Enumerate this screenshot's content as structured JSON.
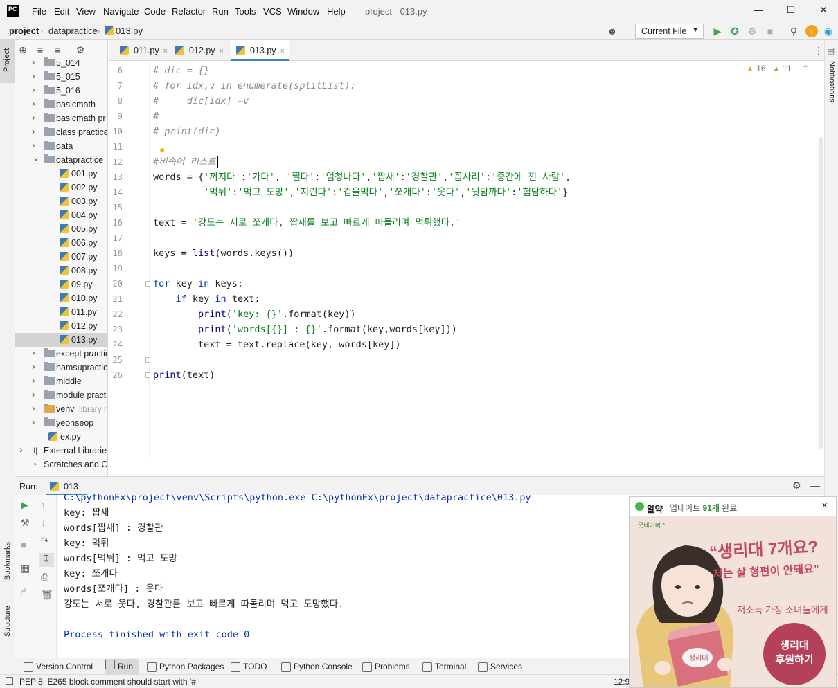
{
  "app": {
    "logo": "PC",
    "window_title": "project - 013.py"
  },
  "menu": [
    "File",
    "Edit",
    "View",
    "Navigate",
    "Code",
    "Refactor",
    "Run",
    "Tools",
    "VCS",
    "Window",
    "Help"
  ],
  "breadcrumb": {
    "project": "project",
    "folder": "datapractice",
    "file": "013.py"
  },
  "run_config": "Current File",
  "sidebar_tabs": {
    "project": "Project",
    "bookmarks": "Bookmarks",
    "structure": "Structure",
    "notifications": "Notifications"
  },
  "tree": [
    {
      "label": "5_014",
      "type": "folder",
      "indent": 1,
      "arrow": "›"
    },
    {
      "label": "5_015",
      "type": "folder",
      "indent": 1,
      "arrow": "›"
    },
    {
      "label": "5_016",
      "type": "folder",
      "indent": 1,
      "arrow": "›"
    },
    {
      "label": "basicmath",
      "type": "folder",
      "indent": 1,
      "arrow": "›"
    },
    {
      "label": "basicmath pr",
      "type": "folder",
      "indent": 1,
      "arrow": "›"
    },
    {
      "label": "class practice",
      "type": "folder",
      "indent": 1,
      "arrow": "›"
    },
    {
      "label": "data",
      "type": "folder",
      "indent": 1,
      "arrow": "›"
    },
    {
      "label": "datapractice",
      "type": "folder",
      "indent": 1,
      "arrow": "⌄"
    },
    {
      "label": "001.py",
      "type": "py",
      "indent": 2
    },
    {
      "label": "002.py",
      "type": "py",
      "indent": 2
    },
    {
      "label": "003.py",
      "type": "py",
      "indent": 2
    },
    {
      "label": "004.py",
      "type": "py",
      "indent": 2
    },
    {
      "label": "005.py",
      "type": "py",
      "indent": 2
    },
    {
      "label": "006.py",
      "type": "py",
      "indent": 2
    },
    {
      "label": "007.py",
      "type": "py",
      "indent": 2
    },
    {
      "label": "008.py",
      "type": "py",
      "indent": 2
    },
    {
      "label": "09.py",
      "type": "py",
      "indent": 2
    },
    {
      "label": "010.py",
      "type": "py",
      "indent": 2
    },
    {
      "label": "011.py",
      "type": "py",
      "indent": 2
    },
    {
      "label": "012.py",
      "type": "py",
      "indent": 2
    },
    {
      "label": "013.py",
      "type": "py",
      "indent": 2,
      "selected": true
    },
    {
      "label": "except practic",
      "type": "folder",
      "indent": 1,
      "arrow": "›"
    },
    {
      "label": "hamsupractic",
      "type": "folder",
      "indent": 1,
      "arrow": "›"
    },
    {
      "label": "middle",
      "type": "folder",
      "indent": 1,
      "arrow": "›"
    },
    {
      "label": "module pract",
      "type": "folder",
      "indent": 1,
      "arrow": "›"
    },
    {
      "label": "venv",
      "type": "folder",
      "indent": 1,
      "arrow": "›",
      "note": "library r"
    },
    {
      "label": "yeonseop",
      "type": "folder",
      "indent": 1,
      "arrow": "›"
    },
    {
      "label": "ex.py",
      "type": "py",
      "indent": 1
    },
    {
      "label": "External Libraries",
      "type": "lib",
      "indent": 0,
      "arrow": "›"
    },
    {
      "label": "Scratches and Co",
      "type": "scratch",
      "indent": 0
    }
  ],
  "tabs": [
    {
      "label": "011.py",
      "close": "×"
    },
    {
      "label": "012.py",
      "close": "×"
    },
    {
      "label": "013.py",
      "close": "×",
      "active": true
    }
  ],
  "inspections": {
    "warnings": "16",
    "weak_warnings": "11"
  },
  "line_numbers": [
    "6",
    "7",
    "8",
    "9",
    "10",
    "11",
    "12",
    "13",
    "14",
    "15",
    "16",
    "17",
    "18",
    "19",
    "20",
    "21",
    "22",
    "23",
    "24",
    "25",
    "26"
  ],
  "code_lines": [
    [
      {
        "t": "# dic = {}",
        "c": "cm"
      }
    ],
    [
      {
        "t": "# for idx,v in enumerate(splitList):",
        "c": "cm"
      }
    ],
    [
      {
        "t": "#     dic[idx] =v",
        "c": "cm"
      }
    ],
    [
      {
        "t": "#",
        "c": "cm"
      }
    ],
    [
      {
        "t": "# print(dic)",
        "c": "cm"
      }
    ],
    [],
    [
      {
        "t": "#비속어 리스트",
        "c": "cm"
      }
    ],
    [
      {
        "t": "words = {",
        "c": ""
      },
      {
        "t": "'꺼지다'",
        "c": "str"
      },
      {
        "t": ":",
        "c": ""
      },
      {
        "t": "'가다'",
        "c": "str"
      },
      {
        "t": ", ",
        "c": ""
      },
      {
        "t": "'쩔다'",
        "c": "str"
      },
      {
        "t": ":",
        "c": ""
      },
      {
        "t": "'엄청나다'",
        "c": "str"
      },
      {
        "t": ",",
        "c": ""
      },
      {
        "t": "'짭새'",
        "c": "str"
      },
      {
        "t": ":",
        "c": ""
      },
      {
        "t": "'경찰관'",
        "c": "str"
      },
      {
        "t": ",",
        "c": ""
      },
      {
        "t": "'꼽사리'",
        "c": "str"
      },
      {
        "t": ":",
        "c": ""
      },
      {
        "t": "'중간에 낀 사람'",
        "c": "str"
      },
      {
        "t": ",",
        "c": ""
      }
    ],
    [
      {
        "t": "         ",
        "c": ""
      },
      {
        "t": "'먹튀'",
        "c": "str"
      },
      {
        "t": ":",
        "c": ""
      },
      {
        "t": "'먹고 도망'",
        "c": "str"
      },
      {
        "t": ",",
        "c": ""
      },
      {
        "t": "'지린다'",
        "c": "str"
      },
      {
        "t": ":",
        "c": ""
      },
      {
        "t": "'겁을먹다'",
        "c": "str"
      },
      {
        "t": ",",
        "c": ""
      },
      {
        "t": "'쪼개다'",
        "c": "str"
      },
      {
        "t": ":",
        "c": ""
      },
      {
        "t": "'웃다'",
        "c": "str"
      },
      {
        "t": ",",
        "c": ""
      },
      {
        "t": "'뒷담까다'",
        "c": "str"
      },
      {
        "t": ":",
        "c": ""
      },
      {
        "t": "'험담하다'",
        "c": "str"
      },
      {
        "t": "}",
        "c": ""
      }
    ],
    [],
    [
      {
        "t": "text = ",
        "c": ""
      },
      {
        "t": "'강도는 서로 쪼개다, 짭새를 보고 빠르게 따돌리며 먹튀했다.'",
        "c": "str"
      }
    ],
    [],
    [
      {
        "t": "keys = ",
        "c": ""
      },
      {
        "t": "list",
        "c": "bi"
      },
      {
        "t": "(words.keys())",
        "c": ""
      }
    ],
    [],
    [
      {
        "t": "for",
        "c": "kw"
      },
      {
        "t": " key ",
        "c": ""
      },
      {
        "t": "in",
        "c": "kw"
      },
      {
        "t": " keys:",
        "c": ""
      }
    ],
    [
      {
        "t": "    ",
        "c": ""
      },
      {
        "t": "if",
        "c": "kw"
      },
      {
        "t": " key ",
        "c": ""
      },
      {
        "t": "in",
        "c": "kw"
      },
      {
        "t": " text:",
        "c": ""
      }
    ],
    [
      {
        "t": "        ",
        "c": ""
      },
      {
        "t": "print",
        "c": "bi"
      },
      {
        "t": "(",
        "c": ""
      },
      {
        "t": "'key: {}'",
        "c": "str"
      },
      {
        "t": ".format(key))",
        "c": ""
      }
    ],
    [
      {
        "t": "        ",
        "c": ""
      },
      {
        "t": "print",
        "c": "bi"
      },
      {
        "t": "(",
        "c": ""
      },
      {
        "t": "'words[{}] : {}'",
        "c": "str"
      },
      {
        "t": ".format(key,words[key]))",
        "c": ""
      }
    ],
    [
      {
        "t": "        text = text.replace(key, words[key])",
        "c": ""
      }
    ],
    [],
    [
      {
        "t": "print",
        "c": "bi"
      },
      {
        "t": "(text)",
        "c": ""
      }
    ]
  ],
  "run": {
    "label": "Run:",
    "config": "013",
    "output": [
      {
        "t": "C:\\pythonEx\\project\\venv\\Scripts\\python.exe C:\\pythonEx\\project\\datapractice\\013.py",
        "c": "blue"
      },
      {
        "t": "key: 짭새",
        "c": ""
      },
      {
        "t": "words[짭새] : 경찰관",
        "c": ""
      },
      {
        "t": "key: 먹튀",
        "c": ""
      },
      {
        "t": "words[먹튀] : 먹고 도망",
        "c": ""
      },
      {
        "t": "key: 쪼개다",
        "c": ""
      },
      {
        "t": "words[쪼개다] : 웃다",
        "c": ""
      },
      {
        "t": "강도는 서로 웃다, 경찰관를 보고 빠르게 따돌리며 먹고 도망했다.",
        "c": ""
      },
      {
        "t": "",
        "c": ""
      },
      {
        "t": "Process finished with exit code 0",
        "c": "blue"
      }
    ]
  },
  "bottom_tools": [
    "Version Control",
    "Run",
    "Python Packages",
    "TODO",
    "Python Console",
    "Problems",
    "Terminal",
    "Services"
  ],
  "status": {
    "message": "PEP 8: E265 block comment should start with '# '",
    "position": "12:9"
  },
  "ad": {
    "app_name": "알약",
    "update_prefix": "업데이트 ",
    "update_count": "91개",
    "update_suffix": " 완료",
    "close": "×",
    "brand": "굿네이버스",
    "headline": "“생리대 7개요?",
    "subline": "저는 살 형편이 안돼요”",
    "caption": "저소득 가정 소녀들에게",
    "cta_line1": "생리대",
    "cta_line2": "후원하기",
    "pack_text": "생리대"
  },
  "colors": {
    "accent": "#4083c9",
    "run_green": "#3fa34d",
    "string": "#067d17",
    "keyword": "#0033b3",
    "comment": "#8c8c8c",
    "cta": "#b5405a"
  }
}
